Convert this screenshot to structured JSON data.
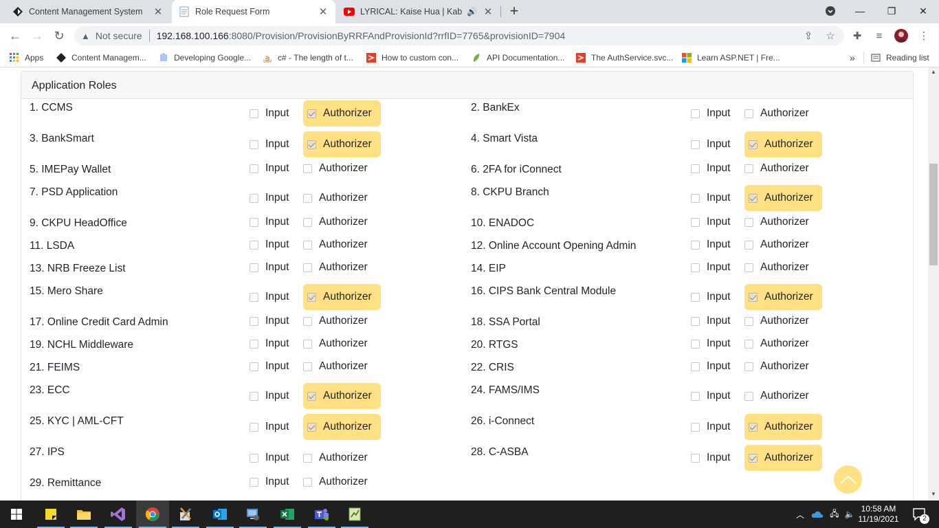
{
  "browser": {
    "tabs": [
      {
        "title": "Content Management System",
        "active": false
      },
      {
        "title": "Role Request Form",
        "active": true
      },
      {
        "title": "LYRICAL: Kaise Hua | Kabir Si",
        "active": false
      }
    ],
    "address": {
      "security": "Not secure",
      "host": "192.168.100.166",
      "path": ":8080/Provision/ProvisionByRRFAndProvisionId?rrfID=7765&provisionID=7904"
    },
    "bookmarks": [
      "Apps",
      "Content Managem...",
      "Developing Google...",
      "c# - The length of t...",
      "How to custom con...",
      "API Documentation...",
      "The AuthService.svc...",
      "Learn ASP.NET | Fre..."
    ],
    "reading_list": "Reading list",
    "overflow": "»"
  },
  "panel": {
    "title": "Application Roles",
    "input_label": "Input",
    "authorizer_label": "Authorizer",
    "roles": [
      {
        "label": "1. CCMS",
        "input": false,
        "authorizer": true
      },
      {
        "label": "2. BankEx",
        "input": false,
        "authorizer": false
      },
      {
        "label": "3. BankSmart",
        "input": false,
        "authorizer": true
      },
      {
        "label": "4. Smart Vista",
        "input": false,
        "authorizer": true
      },
      {
        "label": "5. IMEPay Wallet",
        "input": false,
        "authorizer": false
      },
      {
        "label": "6. 2FA for iConnect",
        "input": false,
        "authorizer": false
      },
      {
        "label": "7. PSD Application",
        "input": false,
        "authorizer": false
      },
      {
        "label": "8. CKPU Branch",
        "input": false,
        "authorizer": true
      },
      {
        "label": "9. CKPU HeadOffice",
        "input": false,
        "authorizer": false
      },
      {
        "label": "10. ENADOC",
        "input": false,
        "authorizer": false
      },
      {
        "label": "11. LSDA",
        "input": false,
        "authorizer": false
      },
      {
        "label": "12. Online Account Opening Admin",
        "input": false,
        "authorizer": false
      },
      {
        "label": "13. NRB Freeze List",
        "input": false,
        "authorizer": false
      },
      {
        "label": "14. EIP",
        "input": false,
        "authorizer": false
      },
      {
        "label": "15. Mero Share",
        "input": false,
        "authorizer": true
      },
      {
        "label": "16. CIPS Bank Central Module",
        "input": false,
        "authorizer": true
      },
      {
        "label": "17. Online Credit Card Admin",
        "input": false,
        "authorizer": false
      },
      {
        "label": "18. SSA Portal",
        "input": false,
        "authorizer": false
      },
      {
        "label": "19. NCHL Middleware",
        "input": false,
        "authorizer": false
      },
      {
        "label": "20. RTGS",
        "input": false,
        "authorizer": false
      },
      {
        "label": "21. FEIMS",
        "input": false,
        "authorizer": false
      },
      {
        "label": "22. CRIS",
        "input": false,
        "authorizer": false
      },
      {
        "label": "23. ECC",
        "input": false,
        "authorizer": true
      },
      {
        "label": "24. FAMS/IMS",
        "input": false,
        "authorizer": false
      },
      {
        "label": "25. KYC | AML-CFT",
        "input": false,
        "authorizer": true
      },
      {
        "label": "26. i-Connect",
        "input": false,
        "authorizer": true
      },
      {
        "label": "27. IPS",
        "input": false,
        "authorizer": false
      },
      {
        "label": "28. C-ASBA",
        "input": false,
        "authorizer": true
      },
      {
        "label": "29. Remittance",
        "input": false,
        "authorizer": false
      }
    ]
  },
  "taskbar": {
    "time": "10:58 AM",
    "date": "11/19/2021",
    "notifications": "2",
    "apps": [
      "sticky-notes",
      "file-explorer",
      "visual-studio",
      "chrome",
      "build-tools",
      "outlook",
      "remote-desktop",
      "excel",
      "teams",
      "notepad-plus"
    ]
  },
  "colors": {
    "highlight": "#ffe083",
    "tabstrip": "#dee1e6",
    "taskbar": "#1f1f1f"
  }
}
